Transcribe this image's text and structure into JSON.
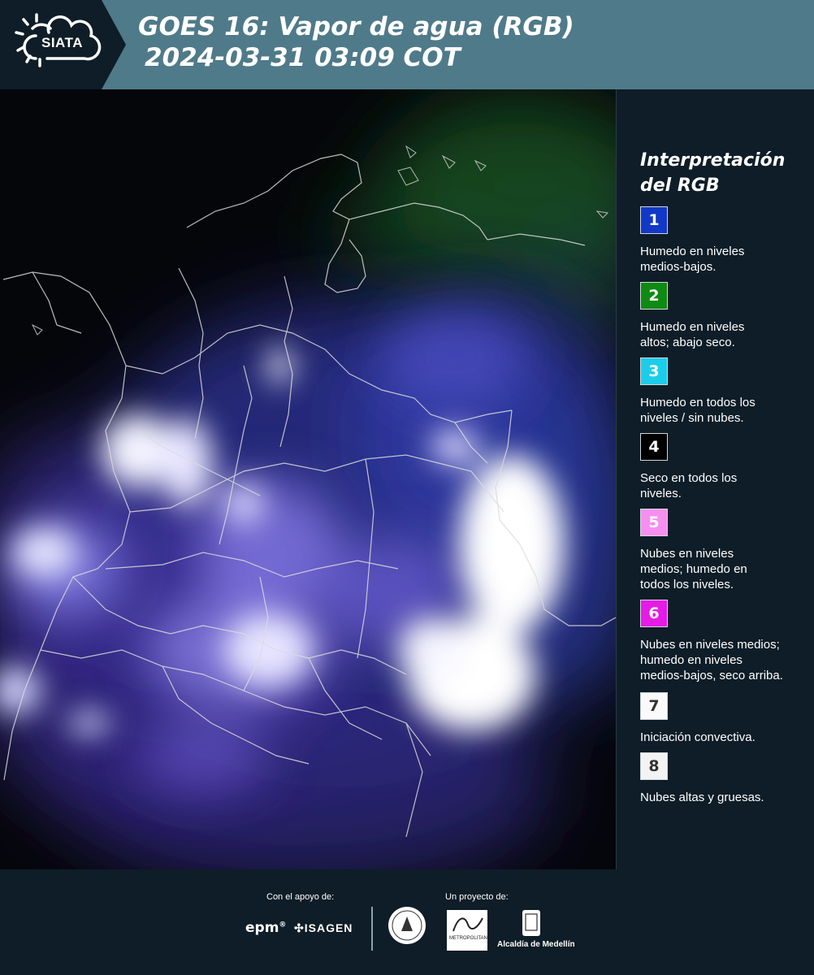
{
  "header": {
    "logo_text": "SIATA",
    "title_line1": "GOES 16: Vapor de agua (RGB)",
    "title_line2": "2024-03-31 03:09 COT"
  },
  "legend": {
    "title_line1": "Interpretación",
    "title_line2": "del RGB",
    "items": [
      {
        "number": "1",
        "color": "#1238c8",
        "text_color": "#ffffff",
        "label_line1": "Humedo en niveles",
        "label_line2": "medios-bajos.",
        "label_line3": ""
      },
      {
        "number": "2",
        "color": "#0f8a12",
        "text_color": "#ffffff",
        "label_line1": "Humedo en niveles",
        "label_line2": "altos; abajo seco.",
        "label_line3": ""
      },
      {
        "number": "3",
        "color": "#1ccdea",
        "text_color": "#ffffff",
        "label_line1": "Humedo en todos los",
        "label_line2": "niveles / sin nubes.",
        "label_line3": ""
      },
      {
        "number": "4",
        "color": "#000000",
        "text_color": "#ffffff",
        "label_line1": "Seco en todos los",
        "label_line2": "niveles.",
        "label_line3": ""
      },
      {
        "number": "5",
        "color": "#f78ff0",
        "text_color": "#ffffff",
        "label_line1": "Nubes en niveles",
        "label_line2": "medios; humedo en",
        "label_line3": "todos los niveles."
      },
      {
        "number": "6",
        "color": "#e51be6",
        "text_color": "#ffffff",
        "label_line1": "Nubes en niveles medios;",
        "label_line2": "humedo en niveles",
        "label_line3": "medios-bajos, seco arriba."
      },
      {
        "number": "7",
        "color": "#fafafa",
        "text_color": "#333333",
        "label_line1": "Iniciación convectiva.",
        "label_line2": "",
        "label_line3": ""
      },
      {
        "number": "8",
        "color": "#f3f3f3",
        "text_color": "#333333",
        "label_line1": "Nubes altas y gruesas.",
        "label_line2": "",
        "label_line3": ""
      }
    ]
  },
  "footer": {
    "support_label": "Con el apoyo de:",
    "project_label": "Un proyecto de:",
    "epm": "epm",
    "isagen": "ISAGEN",
    "metropolitana": "METROPOLITANA",
    "alcaldia": "Alcaldía de Medellín"
  }
}
